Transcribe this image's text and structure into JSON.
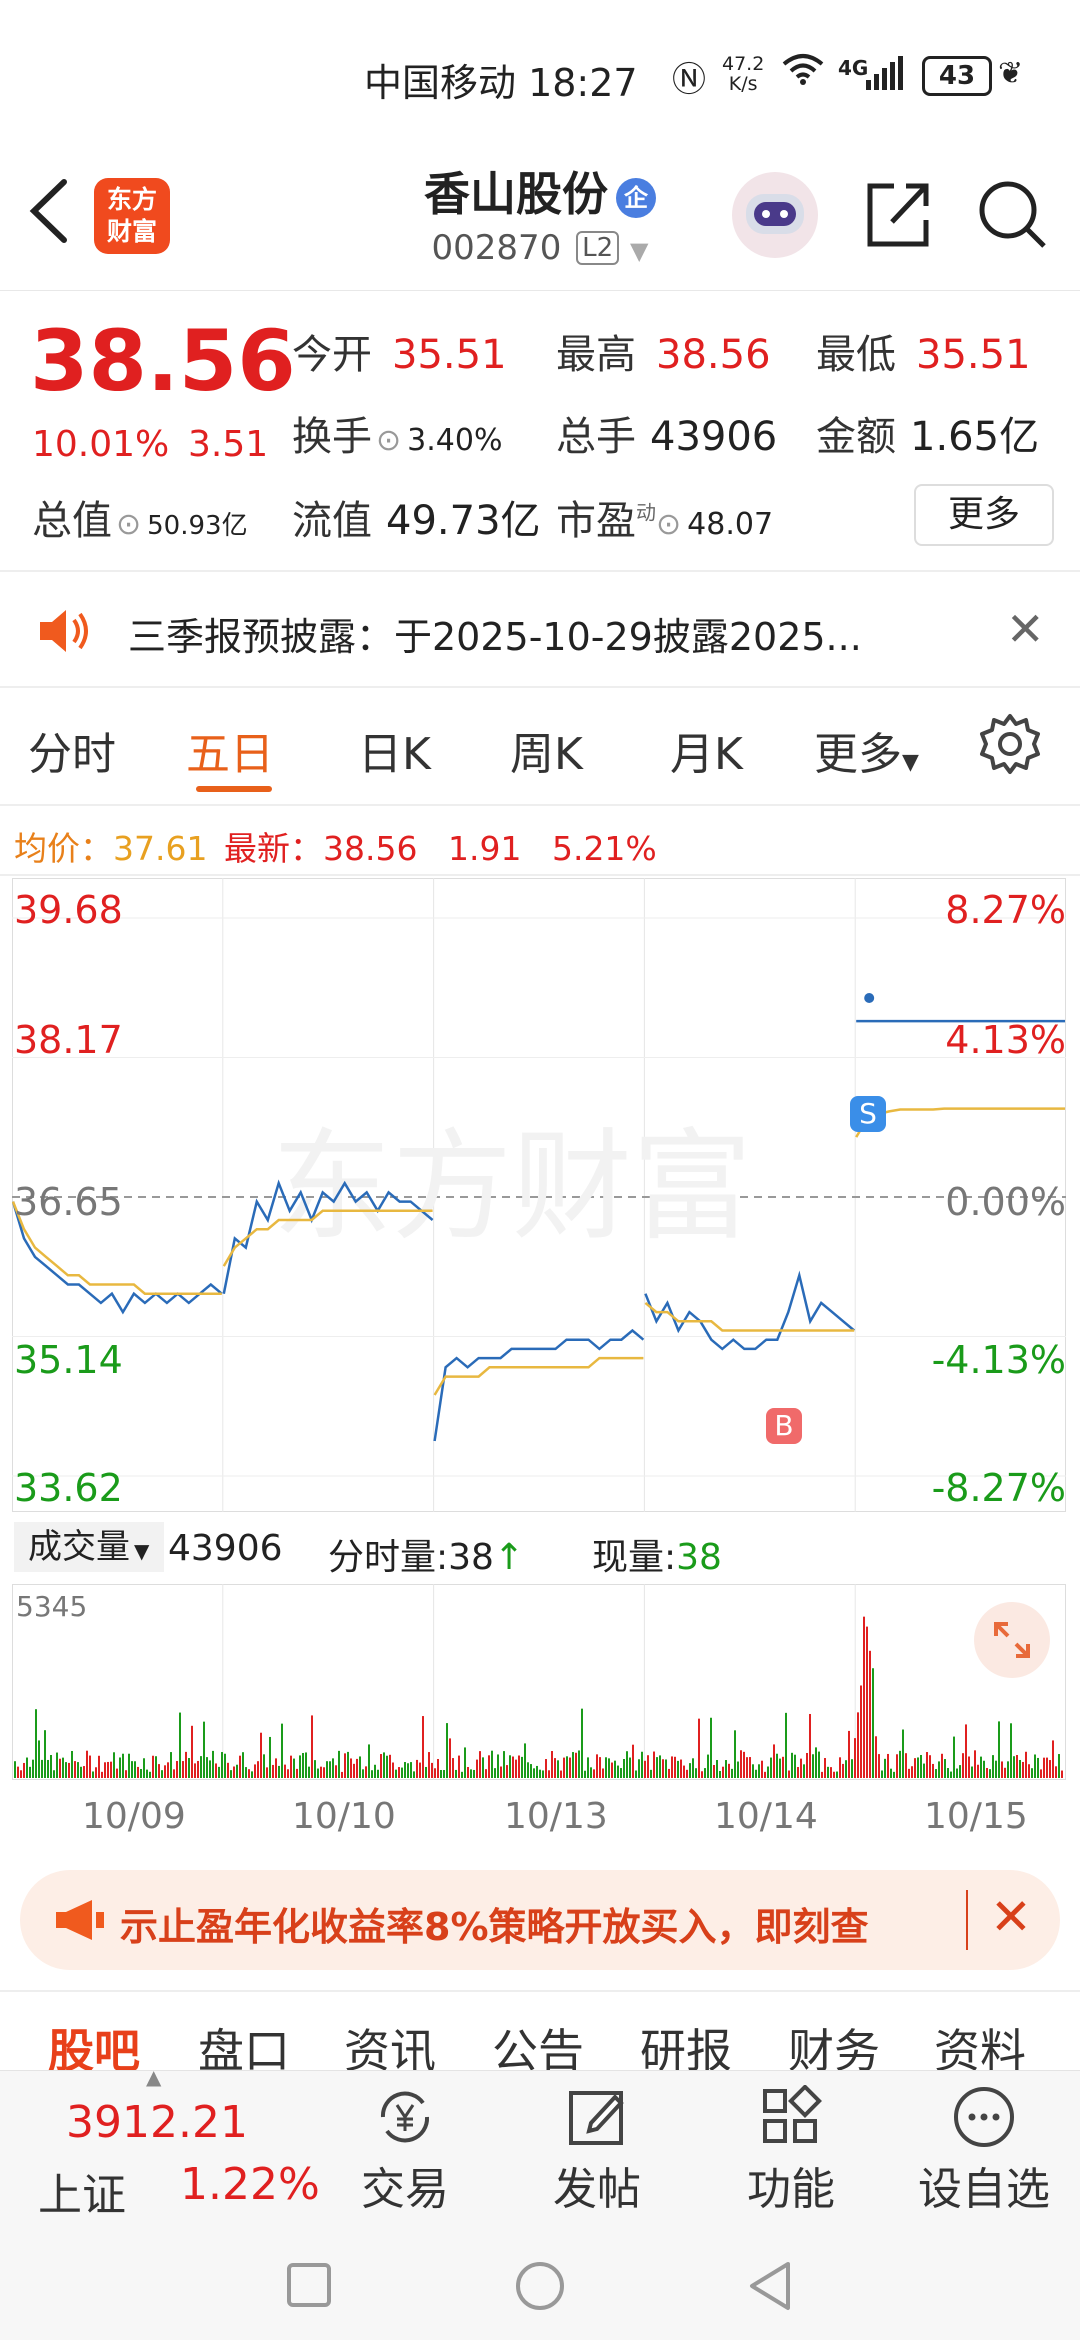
{
  "status_bar": {
    "carrier_time": "中国移动 18:27",
    "net_speed_top": "47.2",
    "net_speed_bottom": "K/s",
    "signal": "4G",
    "battery": "43"
  },
  "header": {
    "logo_line1": "东方",
    "logo_line2": "财富",
    "stock_name": "香山股份",
    "badge": "企",
    "stock_code": "002870",
    "level": "L2"
  },
  "quote": {
    "price": "38.56",
    "change_pct": "10.01%",
    "change": "3.51",
    "open_label": "今开",
    "open": "35.51",
    "high_label": "最高",
    "high": "38.56",
    "low_label": "最低",
    "low": "35.51",
    "turnover_label": "换手",
    "turnover": "3.40%",
    "volume_label": "总手",
    "volume": "43906",
    "amount_label": "金额",
    "amount": "1.65亿",
    "mcap_label": "总值",
    "mcap": "50.93亿",
    "float_label": "流值",
    "float": "49.73亿",
    "pe_label": "市盈",
    "pe_sup": "动",
    "pe": "48.07",
    "more": "更多"
  },
  "notice": {
    "text": "三季报预披露：于2025-10-29披露2025..."
  },
  "tabs": [
    "分时",
    "五日",
    "日K",
    "周K",
    "月K",
    "更多"
  ],
  "tabs_active": 1,
  "info_row": {
    "avg_label": "均价：",
    "avg": "37.61",
    "latest_label": "最新：",
    "latest": "38.56",
    "chg": "1.91",
    "pct": "5.21%"
  },
  "chart_labels": {
    "y_left": [
      "39.68",
      "38.17",
      "36.65",
      "35.14",
      "33.62"
    ],
    "y_right": [
      "8.27%",
      "4.13%",
      "0.00%",
      "-4.13%",
      "-8.27%"
    ],
    "dates": [
      "10/09",
      "10/10",
      "10/13",
      "10/14",
      "10/15"
    ],
    "watermark": "东方财富",
    "marker_s": "S",
    "marker_b": "B"
  },
  "volume_bar": {
    "label": "成交量",
    "total": "43906",
    "tick_label": "分时量:38",
    "now_label": "现量:",
    "now": "38",
    "max": "5345"
  },
  "ad_banner": {
    "text": "示止盈年化收益率8%策略开放买入，即刻查"
  },
  "bottom_tabs": [
    "股吧",
    "盘口",
    "资讯",
    "公告",
    "研报",
    "财务",
    "资料"
  ],
  "bottom_nav": {
    "index_value": "3912.21",
    "index_name": "上证",
    "index_pct": "1.22%",
    "items": [
      "交易",
      "发帖",
      "功能",
      "设自选"
    ]
  },
  "chart_data": {
    "type": "line",
    "title": "",
    "categories": [
      "10/09",
      "10/10",
      "10/13",
      "10/14",
      "10/15"
    ],
    "ylim": [
      33.62,
      39.68
    ],
    "base_price": 36.65,
    "series": [
      {
        "name": "price",
        "color": "#2a6bb8",
        "values": [
          36.6,
          36.2,
          36.0,
          35.9,
          35.8,
          35.7,
          35.7,
          35.6,
          35.5,
          35.6,
          35.4,
          35.6,
          35.5,
          35.6,
          35.5,
          35.6,
          35.5,
          35.6,
          35.7,
          35.6,
          35.6,
          36.2,
          36.1,
          36.6,
          36.4,
          36.8,
          36.5,
          36.7,
          36.4,
          36.7,
          36.6,
          36.8,
          36.6,
          36.7,
          36.5,
          36.7,
          36.6,
          36.6,
          36.5,
          36.4,
          34.0,
          34.8,
          34.9,
          34.8,
          34.9,
          34.9,
          34.9,
          35.0,
          35.0,
          35.0,
          35.0,
          35.0,
          35.1,
          35.1,
          35.1,
          35.0,
          35.1,
          35.1,
          35.2,
          35.1,
          35.6,
          35.3,
          35.5,
          35.2,
          35.4,
          35.3,
          35.1,
          35.0,
          35.1,
          35.0,
          35.0,
          35.1,
          35.1,
          35.4,
          35.8,
          35.3,
          35.5,
          35.4,
          35.3,
          35.2,
          38.56,
          38.56,
          38.56,
          38.56,
          38.56,
          38.56,
          38.56,
          38.56,
          38.56,
          38.56,
          38.56,
          38.56,
          38.56,
          38.56,
          38.56,
          38.56,
          38.56,
          38.56,
          38.56,
          38.56
        ]
      },
      {
        "name": "avg",
        "color": "#e8b840",
        "values": [
          36.6,
          36.3,
          36.1,
          36.0,
          35.9,
          35.8,
          35.8,
          35.7,
          35.7,
          35.7,
          35.7,
          35.7,
          35.6,
          35.6,
          35.6,
          35.6,
          35.6,
          35.6,
          35.6,
          35.6,
          35.9,
          36.1,
          36.2,
          36.3,
          36.3,
          36.4,
          36.4,
          36.4,
          36.4,
          36.5,
          36.5,
          36.5,
          36.5,
          36.5,
          36.5,
          36.5,
          36.5,
          36.5,
          36.5,
          36.5,
          34.5,
          34.7,
          34.7,
          34.7,
          34.7,
          34.8,
          34.8,
          34.8,
          34.8,
          34.8,
          34.8,
          34.8,
          34.8,
          34.8,
          34.8,
          34.9,
          34.9,
          34.9,
          34.9,
          34.9,
          35.5,
          35.4,
          35.4,
          35.3,
          35.3,
          35.3,
          35.3,
          35.2,
          35.2,
          35.2,
          35.2,
          35.2,
          35.2,
          35.2,
          35.2,
          35.2,
          35.2,
          35.2,
          35.2,
          35.2,
          37.3,
          37.5,
          37.55,
          37.58,
          37.6,
          37.6,
          37.6,
          37.6,
          37.61,
          37.61,
          37.61,
          37.61,
          37.61,
          37.61,
          37.61,
          37.61,
          37.61,
          37.61,
          37.61,
          37.61
        ]
      }
    ],
    "volume_max": 5345
  }
}
